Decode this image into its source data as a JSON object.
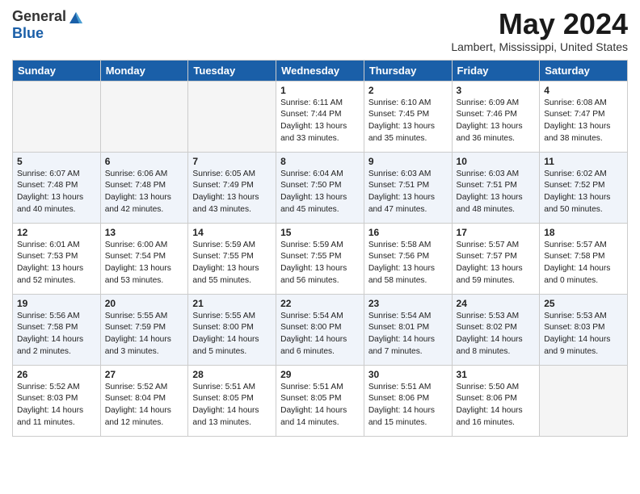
{
  "header": {
    "logo_general": "General",
    "logo_blue": "Blue",
    "month_title": "May 2024",
    "location": "Lambert, Mississippi, United States"
  },
  "weekdays": [
    "Sunday",
    "Monday",
    "Tuesday",
    "Wednesday",
    "Thursday",
    "Friday",
    "Saturday"
  ],
  "weeks": [
    [
      {
        "day": "",
        "info": ""
      },
      {
        "day": "",
        "info": ""
      },
      {
        "day": "",
        "info": ""
      },
      {
        "day": "1",
        "info": "Sunrise: 6:11 AM\nSunset: 7:44 PM\nDaylight: 13 hours\nand 33 minutes."
      },
      {
        "day": "2",
        "info": "Sunrise: 6:10 AM\nSunset: 7:45 PM\nDaylight: 13 hours\nand 35 minutes."
      },
      {
        "day": "3",
        "info": "Sunrise: 6:09 AM\nSunset: 7:46 PM\nDaylight: 13 hours\nand 36 minutes."
      },
      {
        "day": "4",
        "info": "Sunrise: 6:08 AM\nSunset: 7:47 PM\nDaylight: 13 hours\nand 38 minutes."
      }
    ],
    [
      {
        "day": "5",
        "info": "Sunrise: 6:07 AM\nSunset: 7:48 PM\nDaylight: 13 hours\nand 40 minutes."
      },
      {
        "day": "6",
        "info": "Sunrise: 6:06 AM\nSunset: 7:48 PM\nDaylight: 13 hours\nand 42 minutes."
      },
      {
        "day": "7",
        "info": "Sunrise: 6:05 AM\nSunset: 7:49 PM\nDaylight: 13 hours\nand 43 minutes."
      },
      {
        "day": "8",
        "info": "Sunrise: 6:04 AM\nSunset: 7:50 PM\nDaylight: 13 hours\nand 45 minutes."
      },
      {
        "day": "9",
        "info": "Sunrise: 6:03 AM\nSunset: 7:51 PM\nDaylight: 13 hours\nand 47 minutes."
      },
      {
        "day": "10",
        "info": "Sunrise: 6:03 AM\nSunset: 7:51 PM\nDaylight: 13 hours\nand 48 minutes."
      },
      {
        "day": "11",
        "info": "Sunrise: 6:02 AM\nSunset: 7:52 PM\nDaylight: 13 hours\nand 50 minutes."
      }
    ],
    [
      {
        "day": "12",
        "info": "Sunrise: 6:01 AM\nSunset: 7:53 PM\nDaylight: 13 hours\nand 52 minutes."
      },
      {
        "day": "13",
        "info": "Sunrise: 6:00 AM\nSunset: 7:54 PM\nDaylight: 13 hours\nand 53 minutes."
      },
      {
        "day": "14",
        "info": "Sunrise: 5:59 AM\nSunset: 7:55 PM\nDaylight: 13 hours\nand 55 minutes."
      },
      {
        "day": "15",
        "info": "Sunrise: 5:59 AM\nSunset: 7:55 PM\nDaylight: 13 hours\nand 56 minutes."
      },
      {
        "day": "16",
        "info": "Sunrise: 5:58 AM\nSunset: 7:56 PM\nDaylight: 13 hours\nand 58 minutes."
      },
      {
        "day": "17",
        "info": "Sunrise: 5:57 AM\nSunset: 7:57 PM\nDaylight: 13 hours\nand 59 minutes."
      },
      {
        "day": "18",
        "info": "Sunrise: 5:57 AM\nSunset: 7:58 PM\nDaylight: 14 hours\nand 0 minutes."
      }
    ],
    [
      {
        "day": "19",
        "info": "Sunrise: 5:56 AM\nSunset: 7:58 PM\nDaylight: 14 hours\nand 2 minutes."
      },
      {
        "day": "20",
        "info": "Sunrise: 5:55 AM\nSunset: 7:59 PM\nDaylight: 14 hours\nand 3 minutes."
      },
      {
        "day": "21",
        "info": "Sunrise: 5:55 AM\nSunset: 8:00 PM\nDaylight: 14 hours\nand 5 minutes."
      },
      {
        "day": "22",
        "info": "Sunrise: 5:54 AM\nSunset: 8:00 PM\nDaylight: 14 hours\nand 6 minutes."
      },
      {
        "day": "23",
        "info": "Sunrise: 5:54 AM\nSunset: 8:01 PM\nDaylight: 14 hours\nand 7 minutes."
      },
      {
        "day": "24",
        "info": "Sunrise: 5:53 AM\nSunset: 8:02 PM\nDaylight: 14 hours\nand 8 minutes."
      },
      {
        "day": "25",
        "info": "Sunrise: 5:53 AM\nSunset: 8:03 PM\nDaylight: 14 hours\nand 9 minutes."
      }
    ],
    [
      {
        "day": "26",
        "info": "Sunrise: 5:52 AM\nSunset: 8:03 PM\nDaylight: 14 hours\nand 11 minutes."
      },
      {
        "day": "27",
        "info": "Sunrise: 5:52 AM\nSunset: 8:04 PM\nDaylight: 14 hours\nand 12 minutes."
      },
      {
        "day": "28",
        "info": "Sunrise: 5:51 AM\nSunset: 8:05 PM\nDaylight: 14 hours\nand 13 minutes."
      },
      {
        "day": "29",
        "info": "Sunrise: 5:51 AM\nSunset: 8:05 PM\nDaylight: 14 hours\nand 14 minutes."
      },
      {
        "day": "30",
        "info": "Sunrise: 5:51 AM\nSunset: 8:06 PM\nDaylight: 14 hours\nand 15 minutes."
      },
      {
        "day": "31",
        "info": "Sunrise: 5:50 AM\nSunset: 8:06 PM\nDaylight: 14 hours\nand 16 minutes."
      },
      {
        "day": "",
        "info": ""
      }
    ]
  ]
}
